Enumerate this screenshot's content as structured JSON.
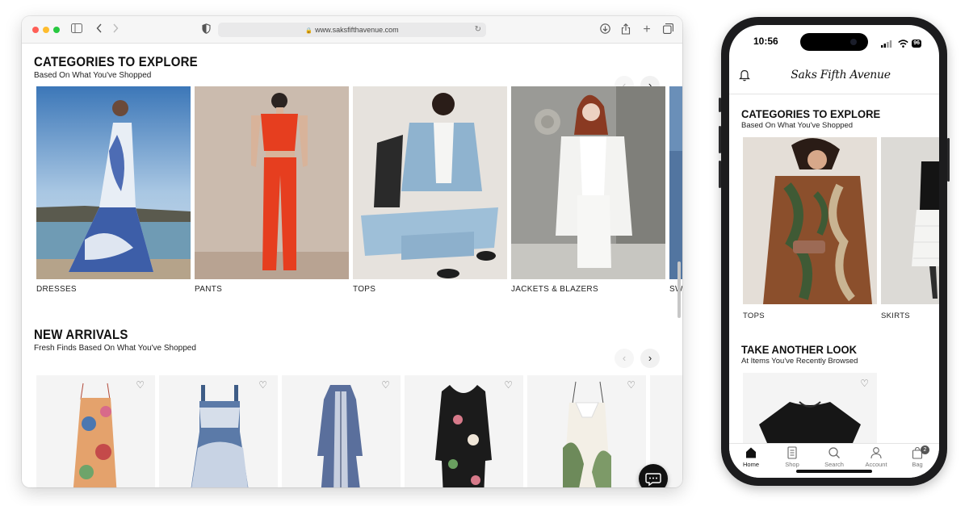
{
  "browser": {
    "url": "www.saksfifthavenue.com"
  },
  "desktop": {
    "categories": {
      "title": "CATEGORIES TO EXPLORE",
      "subtitle": "Based On What You've Shopped",
      "items": [
        {
          "label": "DRESSES"
        },
        {
          "label": "PANTS"
        },
        {
          "label": "TOPS"
        },
        {
          "label": "JACKETS & BLAZERS"
        },
        {
          "label": "SW"
        }
      ]
    },
    "new_arrivals": {
      "title": "NEW ARRIVALS",
      "subtitle": "Fresh Finds Based On What You've Shopped"
    }
  },
  "phone": {
    "status": {
      "time": "10:56",
      "battery": "96"
    },
    "brand": "Saks Fifth Avenue",
    "categories": {
      "title": "CATEGORIES TO EXPLORE",
      "subtitle": "Based On What You've Shopped",
      "items": [
        {
          "label": "TOPS"
        },
        {
          "label": "SKIRTS"
        }
      ]
    },
    "take_another_look": {
      "title": "TAKE ANOTHER LOOK",
      "subtitle": "At Items You've Recently Browsed"
    },
    "tabs": [
      {
        "label": "Home",
        "icon": "home-icon",
        "active": true
      },
      {
        "label": "Shop",
        "icon": "shop-icon"
      },
      {
        "label": "Search",
        "icon": "search-icon"
      },
      {
        "label": "Account",
        "icon": "account-icon"
      },
      {
        "label": "Bag",
        "icon": "bag-icon",
        "badge": "2"
      }
    ]
  }
}
